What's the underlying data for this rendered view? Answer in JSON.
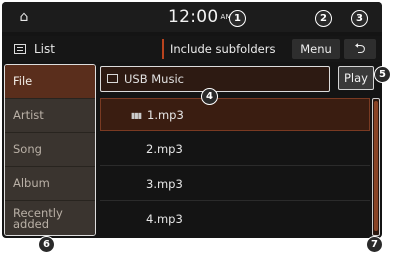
{
  "topbar": {
    "home_icon": "home-icon",
    "time": "12:00",
    "ampm": "AM"
  },
  "subbar": {
    "title": "List",
    "list_icon": "list-icon",
    "include_subfolders_label": "Include subfolders",
    "menu_label": "Menu",
    "back_icon": "back-arrow-icon"
  },
  "categories": [
    {
      "label": "File",
      "selected": true
    },
    {
      "label": "Artist",
      "selected": false
    },
    {
      "label": "Song",
      "selected": false
    },
    {
      "label": "Album",
      "selected": false
    },
    {
      "label": "Recently added",
      "selected": false
    }
  ],
  "folder": {
    "icon": "folder-icon",
    "name": "USB Music"
  },
  "play_label": "Play",
  "files": [
    {
      "name": "1.mp3",
      "playing": true
    },
    {
      "name": "2.mp3",
      "playing": false
    },
    {
      "name": "3.mp3",
      "playing": false
    },
    {
      "name": "4.mp3",
      "playing": false
    }
  ],
  "callouts": [
    "1",
    "2",
    "3",
    "4",
    "5",
    "6",
    "7"
  ],
  "colors": {
    "accent": "#b8431e",
    "selected_category": "#5a2e1c",
    "panel": "#3a342f",
    "background": "#141414"
  }
}
